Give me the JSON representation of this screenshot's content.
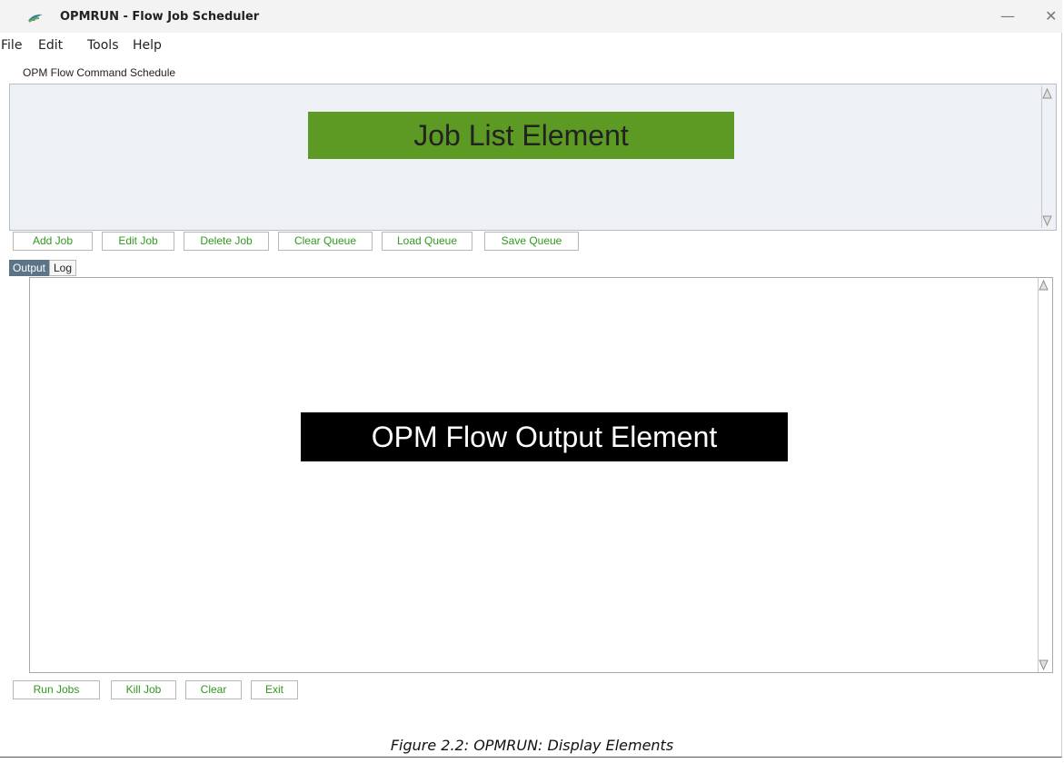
{
  "window": {
    "title": "OPMRUN - Flow Job Scheduler",
    "minimize_glyph": "—",
    "close_glyph": "✕"
  },
  "menu": {
    "file": "File",
    "edit": "Edit",
    "tools": "Tools",
    "help": "Help"
  },
  "schedule": {
    "label": "OPM Flow Command Schedule",
    "job_list_label": "Job List Element",
    "job_list_label_color": "#5c9a23"
  },
  "job_buttons": {
    "add": "Add Job",
    "edit": "Edit Job",
    "delete": "Delete Job",
    "clear_queue": "Clear Queue",
    "load_queue": "Load Queue",
    "save_queue": "Save Queue"
  },
  "tabs": {
    "output": "Output",
    "log": "Log",
    "active": "Output"
  },
  "output": {
    "label": "OPM Flow Output Element"
  },
  "run_buttons": {
    "run": "Run Jobs",
    "kill": "Kill Job",
    "clear": "Clear",
    "exit": "Exit"
  },
  "caption": "Figure 2.2: OPMRUN: Display Elements",
  "colors": {
    "button_text": "#2f9a1c",
    "tab_active_bg": "#5d7486"
  }
}
